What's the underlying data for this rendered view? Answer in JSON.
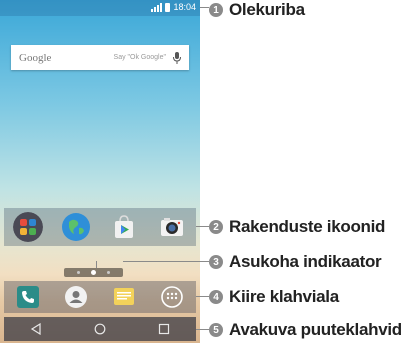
{
  "status_bar": {
    "time": "18:04"
  },
  "search": {
    "logo": "Google",
    "hint": "Say \"Ok Google\""
  },
  "page_indicator": {
    "pages": 3,
    "current": 2
  },
  "callouts": [
    {
      "number": "1",
      "label": "Olekuriba"
    },
    {
      "number": "2",
      "label": "Rakenduste ikoonid"
    },
    {
      "number": "3",
      "label": "Asukoha indikaator"
    },
    {
      "number": "4",
      "label": "Kiire klahviala"
    },
    {
      "number": "5",
      "label": "Avakuva puuteklahvid"
    }
  ],
  "colors": {
    "callout_gray": "#8a8a8a",
    "phone_icon": "#2b8c88",
    "message_icon": "#f3d25a"
  }
}
